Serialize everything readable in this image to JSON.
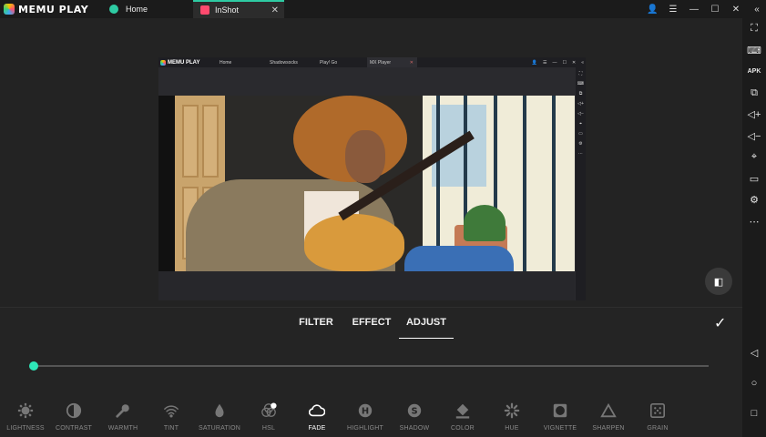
{
  "app": {
    "logo_text": "MEMU PLAY"
  },
  "tabs": [
    {
      "label": "Home"
    },
    {
      "label": "InShot",
      "close": "✕"
    }
  ],
  "window_controls": [
    "👤",
    "☰",
    "—",
    "☐",
    "✕",
    "«"
  ],
  "sidebar_icons": [
    "fullscreen-icon",
    "keyboard-icon",
    "apk-icon",
    "multi-window-icon",
    "volume-up-icon",
    "volume-down-icon",
    "location-icon",
    "folder-icon",
    "settings-icon",
    "more-icon"
  ],
  "sidebar_glyphs": {
    "fullscreen": "⛶",
    "keyboard": "⌨",
    "apk": "APK",
    "multi": "⧉",
    "volup": "◁+",
    "voldown": "◁−",
    "location": "⌖",
    "folder": "▭",
    "settings": "⚙",
    "more": "⋯",
    "back": "◁",
    "home": "○",
    "recent": "□"
  },
  "nested": {
    "logo_text": "MEMU PLAY",
    "tabs": [
      "Home",
      "Shadowsocks",
      "Play! Go",
      "MX Player"
    ],
    "close": "✕"
  },
  "editor": {
    "tabs": {
      "filter": "FILTER",
      "effect": "EFFECT",
      "adjust": "ADJUST"
    },
    "active_tab": "ADJUST",
    "confirm": "✓",
    "compare": "◧",
    "slider_value": 0,
    "accent_color": "#2ee6b8"
  },
  "tools": [
    {
      "label": "LIGHTNESS",
      "icon": "lightness-icon"
    },
    {
      "label": "CONTRAST",
      "icon": "contrast-icon"
    },
    {
      "label": "WARMTH",
      "icon": "warmth-icon"
    },
    {
      "label": "TINT",
      "icon": "tint-icon"
    },
    {
      "label": "SATURATION",
      "icon": "saturation-icon"
    },
    {
      "label": "HSL",
      "icon": "hsl-icon"
    },
    {
      "label": "FADE",
      "icon": "fade-icon",
      "active": true
    },
    {
      "label": "HIGHLIGHT",
      "icon": "highlight-icon"
    },
    {
      "label": "SHADOW",
      "icon": "shadow-icon"
    },
    {
      "label": "COLOR",
      "icon": "color-icon"
    },
    {
      "label": "HUE",
      "icon": "hue-icon"
    },
    {
      "label": "VIGNETTE",
      "icon": "vignette-icon"
    },
    {
      "label": "SHARPEN",
      "icon": "sharpen-icon"
    },
    {
      "label": "GRAIN",
      "icon": "grain-icon"
    }
  ]
}
